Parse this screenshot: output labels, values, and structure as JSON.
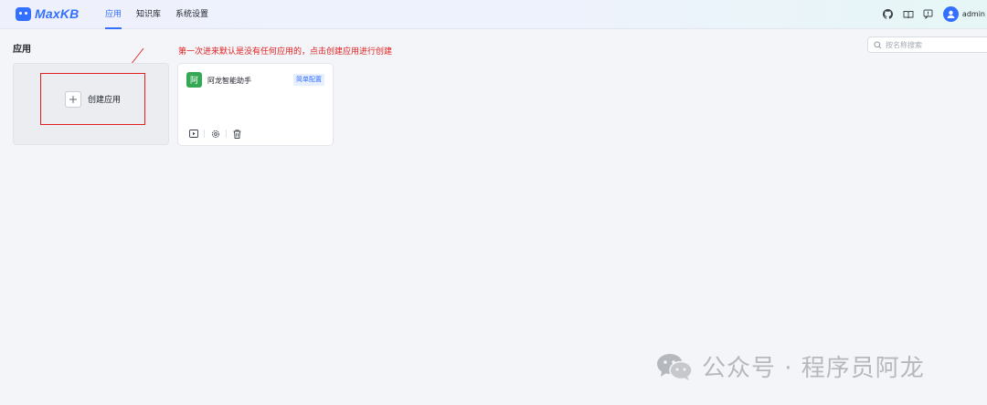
{
  "header": {
    "logo_text": "MaxKB",
    "nav": [
      {
        "label": "应用",
        "active": true
      },
      {
        "label": "知识库",
        "active": false
      },
      {
        "label": "系统设置",
        "active": false
      }
    ],
    "icons": [
      "github-icon",
      "book-icon",
      "feedback-icon"
    ],
    "username": "admin"
  },
  "main": {
    "title": "应用",
    "annotation": "第一次进来默认是没有任何应用的，点击创建应用进行创建",
    "search_placeholder": "按名称搜索",
    "create_label": "创建应用",
    "apps": [
      {
        "avatar_text": "阿",
        "name": "阿龙智能助手",
        "badge": "简单配置"
      }
    ]
  },
  "watermark": {
    "text": "公众号 · 程序员阿龙"
  },
  "colors": {
    "accent": "#3370ff",
    "annotation": "#e02020",
    "app_avatar": "#34a853"
  }
}
